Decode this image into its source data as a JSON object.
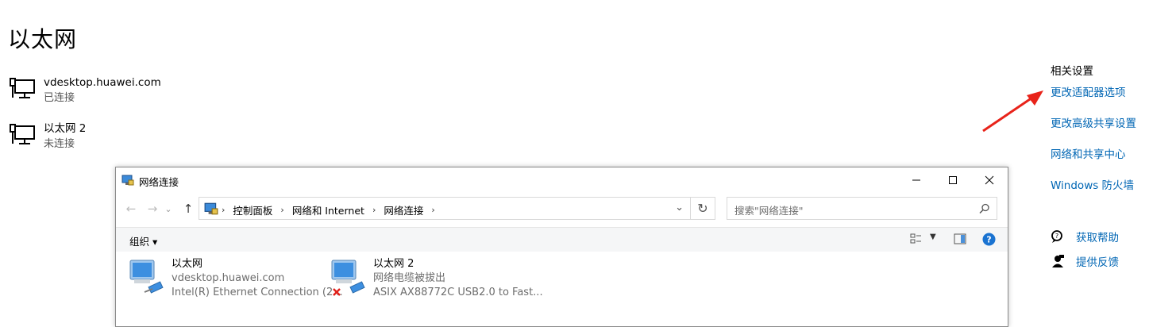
{
  "page": {
    "title": "以太网"
  },
  "connections": [
    {
      "name": "vdesktop.huawei.com",
      "status": "已连接"
    },
    {
      "name": "以太网 2",
      "status": "未连接"
    }
  ],
  "related": {
    "header": "相关设置",
    "links": [
      "更改适配器选项",
      "更改高级共享设置",
      "网络和共享中心",
      "Windows 防火墙"
    ]
  },
  "help": {
    "get_help": "获取帮助",
    "feedback": "提供反馈"
  },
  "explorer": {
    "title": "网络连接",
    "breadcrumbs": [
      "控制面板",
      "网络和 Internet",
      "网络连接"
    ],
    "search_placeholder": "搜索\"网络连接\"",
    "organize": "组织 ▾",
    "items": [
      {
        "name": "以太网",
        "line2": "vdesktop.huawei.com",
        "line3": "Intel(R) Ethernet Connection (2..."
      },
      {
        "name": "以太网 2",
        "line2": "网络电缆被拔出",
        "line3": "ASIX AX88772C USB2.0 to Fast..."
      }
    ]
  },
  "colors": {
    "link": "#0066b4",
    "arrow": "#e8231a",
    "help_icon": "#1a73d1"
  }
}
